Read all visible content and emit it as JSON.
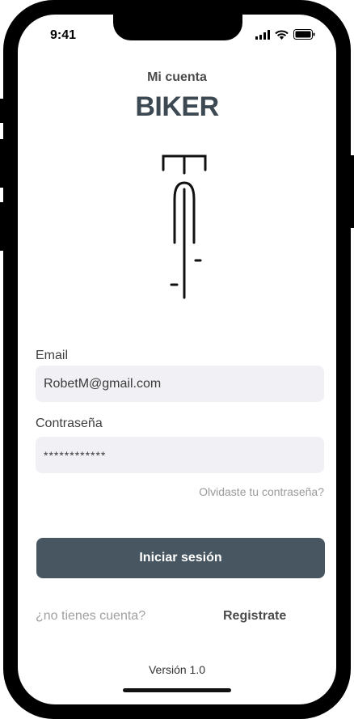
{
  "status_bar": {
    "time": "9:41"
  },
  "header": {
    "subtitle": "Mi cuenta",
    "logo": "BIKER"
  },
  "illustration": {
    "icon": "bicycle-front-icon"
  },
  "email": {
    "label": "Email",
    "value": "RobetM@gmail.com"
  },
  "password": {
    "label": "Contraseña",
    "value": "************"
  },
  "forgot_link": "Olvidaste tu contraseña?",
  "login_button": "Iniciar sesión",
  "signup": {
    "prompt": "¿no tienes cuenta?",
    "link": "Registrate"
  },
  "version": "Versión 1.0",
  "colors": {
    "primary": "#475660",
    "logo": "#3c4852",
    "field_bg": "#f1f1f5"
  }
}
